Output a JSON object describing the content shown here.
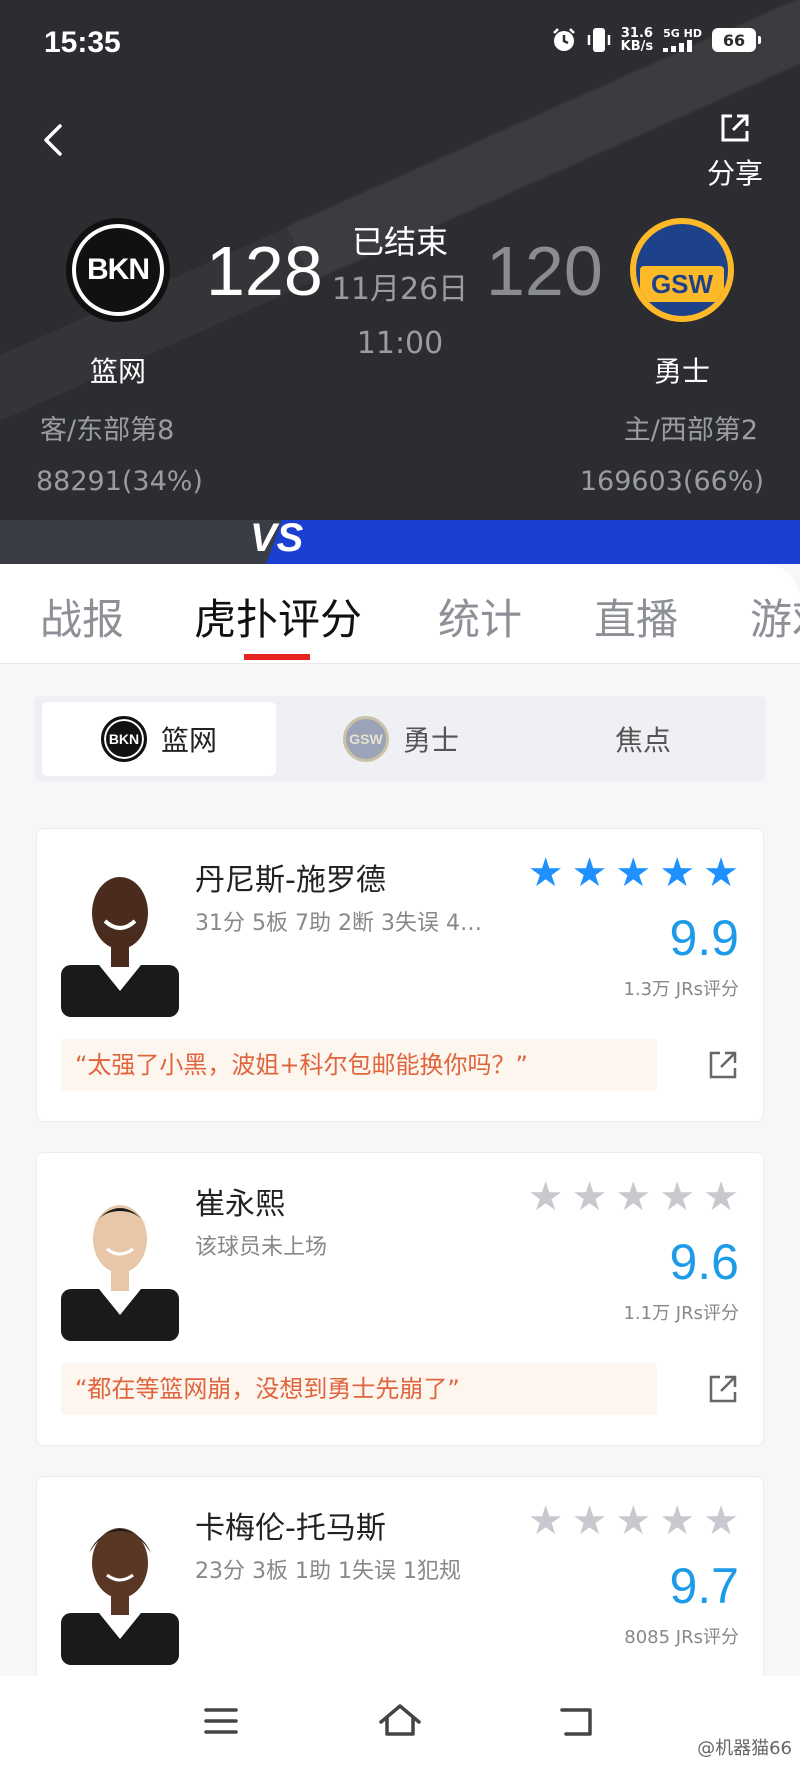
{
  "status_bar": {
    "time": "15:35",
    "net_speed_value": "31.6",
    "net_speed_unit": "KB/s",
    "network_top": "5G HD",
    "battery": "66"
  },
  "header": {
    "share_label": "分享",
    "game_status": "已结束",
    "game_date": "11月26日",
    "game_time": "11:00",
    "away": {
      "name": "篮网",
      "abbr": "BKN",
      "score": "128",
      "rank": "客/东部第8",
      "votes": "88291(34%)"
    },
    "home": {
      "name": "勇士",
      "abbr": "GSW",
      "score": "120",
      "rank": "主/西部第2",
      "votes": "169603(66%)"
    },
    "vs_label": "VS"
  },
  "tabs": [
    {
      "label": "战报",
      "active": false
    },
    {
      "label": "虎扑评分",
      "active": true
    },
    {
      "label": "统计",
      "active": false
    },
    {
      "label": "直播",
      "active": false
    },
    {
      "label": "游戏",
      "active": false
    }
  ],
  "team_switch": [
    {
      "label": "篮网",
      "logo": "BKN",
      "active": true
    },
    {
      "label": "勇士",
      "logo": "GSW",
      "active": false
    },
    {
      "label": "焦点",
      "active": false
    }
  ],
  "players": [
    {
      "name": "丹尼斯-施罗德",
      "stats": "31分 5板 7助 2断 3失误 4…",
      "stars_filled": 5,
      "stars_total": 5,
      "rating": "9.9",
      "votes": "1.3万 JRs评分",
      "quote": "“太强了小黑，波姐+科尔包邮能换你吗？”",
      "skin": "#4a2c1e"
    },
    {
      "name": "崔永熙",
      "stats": "该球员未上场",
      "stars_filled": 0,
      "stars_total": 5,
      "rating": "9.6",
      "votes": "1.1万 JRs评分",
      "quote": "“都在等篮网崩，没想到勇士先崩了”",
      "skin": "#e8c7a8"
    },
    {
      "name": "卡梅伦-托马斯",
      "stats": "23分 3板 1助 1失误 1犯规",
      "stars_filled": 0,
      "stars_total": 5,
      "rating": "9.7",
      "votes": "8085 JRs评分",
      "quote": "",
      "skin": "#5a3624"
    }
  ],
  "watermark": "@机器猫66",
  "colors": {
    "header_bg": "#2b2d31",
    "accent_red": "#e52422",
    "rating_blue": "#1e9be8",
    "star_blue": "#1e90ff",
    "quote_text": "#e0643c"
  }
}
